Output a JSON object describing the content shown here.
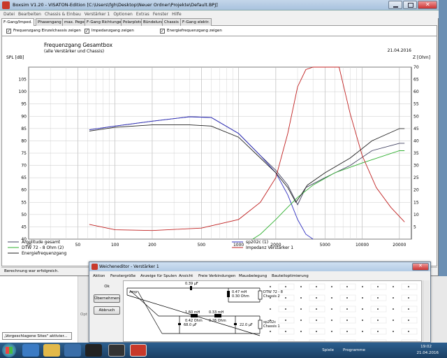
{
  "window": {
    "title": "Boxsim V1.20 - VISATON-Edition [C:\\Users\\fgh\\Desktop\\Neuer Ordner\\Projekte\\Default.BPJ]"
  },
  "menu": [
    "Datei",
    "Bearbeiten",
    "Chassis & Einbau",
    "Verstärker 1",
    "Optionen",
    "Extras",
    "Fenster",
    "Hilfe"
  ],
  "tabs": [
    "F-Gang/Imped.",
    "Phasengang",
    "max. Pegel",
    "F-Gang Richtungen",
    "Polarplots",
    "Bündelung",
    "Chassis",
    "F-Gang elektr."
  ],
  "options": {
    "opt1": "Frequenzgang Einzelchassis zeigen",
    "opt2": "Impedanzgang zeigen",
    "opt3": "Energiefrequenzgang zeigen"
  },
  "chart_data": {
    "type": "line",
    "title": "Frequenzgang Gesamtbox",
    "subtitle": "(alle Verstärker und Chassis)",
    "date": "21.04.2016",
    "ylabel_left": "SPL [dB]",
    "ylabel_right": "Z [Ohm]",
    "xscale": "log",
    "xlim": [
      20,
      25000
    ],
    "ylim_left": [
      40,
      110
    ],
    "ylim_right": [
      0,
      70
    ],
    "xticks": [
      20,
      50,
      100,
      200,
      500,
      1000,
      2000,
      5000,
      10000,
      20000
    ],
    "xtick_labels": [
      "20",
      "50",
      "100",
      "200",
      "500",
      "1000",
      "2000",
      "5000",
      "10000",
      "20000"
    ],
    "yticks_left": [
      40,
      45,
      50,
      55,
      60,
      65,
      70,
      75,
      80,
      85,
      90,
      95,
      100,
      105
    ],
    "yticks_right": [
      5,
      10,
      15,
      20,
      25,
      30,
      35,
      40,
      45,
      50,
      55,
      60,
      65,
      70
    ],
    "grid": true,
    "series": [
      {
        "name": "Amplitude gesamt",
        "color": "#404060",
        "axis": "left",
        "x": [
          62,
          100,
          200,
          400,
          600,
          1000,
          1500,
          2000,
          2500,
          2800,
          3000,
          3500,
          5000,
          8000,
          12000,
          20000,
          22000
        ],
        "y": [
          84.5,
          86,
          88,
          89.8,
          89.5,
          83,
          74,
          68,
          62,
          57,
          54,
          61,
          65,
          70,
          76,
          79,
          79
        ]
      },
      {
        "name": "sp202c (1)",
        "color": "#3030c0",
        "axis": "left",
        "x": [
          62,
          100,
          200,
          400,
          600,
          1000,
          1500,
          2000,
          2500,
          3000,
          3500,
          4000
        ],
        "y": [
          84.5,
          86,
          88,
          89.8,
          89.5,
          83,
          74,
          67,
          58,
          48,
          42,
          40
        ]
      },
      {
        "name": "DTW 72 - 8 Ohm (2)",
        "color": "#30b030",
        "axis": "left",
        "x": [
          1300,
          1500,
          2000,
          2500,
          3000,
          4000,
          6000,
          10000,
          20000,
          22000
        ],
        "y": [
          40,
          42,
          48,
          53,
          57,
          62,
          67,
          71,
          76,
          76
        ]
      },
      {
        "name": "Impedanz Verstärker 1",
        "color": "#c02020",
        "axis": "right",
        "x": [
          62,
          100,
          200,
          500,
          1000,
          1500,
          2000,
          2500,
          3000,
          3500,
          4000,
          5000,
          6500,
          8000,
          10000,
          13000,
          17000,
          22000
        ],
        "y": [
          6,
          3.8,
          3.5,
          4.5,
          8,
          15,
          25,
          43,
          62,
          69,
          70,
          70,
          70,
          51,
          34,
          21,
          13,
          7
        ]
      },
      {
        "name": "Energiefrequenzgang",
        "color": "#202020",
        "axis": "left",
        "x": [
          62,
          100,
          200,
          400,
          600,
          1000,
          1500,
          2000,
          2500,
          2900,
          3200,
          3600,
          5000,
          8000,
          12000,
          20000,
          22000
        ],
        "y": [
          84,
          85.5,
          86.5,
          86.5,
          86,
          81.5,
          73,
          67,
          61,
          55,
          58,
          62,
          67,
          73,
          80,
          85,
          85
        ]
      }
    ]
  },
  "status": "Berechnung war erfolgreich.",
  "background": {
    "tip_text": "„Vorgeschlagene Sites\" aktivier...",
    "side_text": "Opt"
  },
  "dialog": {
    "title": "Weicheneditor - Verstärker 1",
    "menu": [
      "Aktion",
      "Fenstergröße",
      "Anzeige für Spulen",
      "Ansicht",
      "Freie Verbindungen",
      "Mausbelegung",
      "Bauteiloptimierung"
    ],
    "buttons": {
      "ok": "Ok",
      "apply": "Übernehmen",
      "cancel": "Abbruch"
    },
    "components": {
      "amp_label": "Amp",
      "cap1": "0.39 µF",
      "coil1_l": "0.47 mH",
      "coil1_r": "0.30 Ohm",
      "coil2_l": "1.60 mH",
      "coil2_r": "0.42 Ohm",
      "coil3_l": "0.33 mH",
      "coil3_r": "0.26 Ohm",
      "cap2": "68.0 µF",
      "cap3": "22.0 µF",
      "tweeter_name": "DTW 72 - 8",
      "tweeter_ch": "Chassis 2",
      "woofer_name": "sp202c",
      "woofer_ch": "Chassis 1"
    }
  },
  "taskbar": {
    "tray1": "Spiele",
    "tray2": "Programme",
    "time": "19:02",
    "date": "21.04.2016"
  }
}
